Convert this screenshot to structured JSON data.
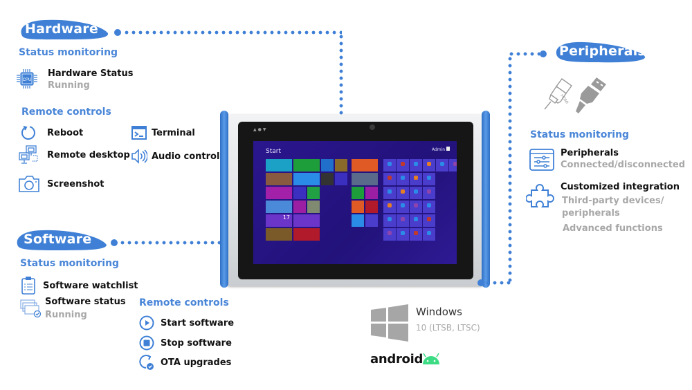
{
  "hardware": {
    "title": "Hardware",
    "status_monitoring": {
      "heading": "Status monitoring",
      "items": [
        {
          "icon": "cpu-icon",
          "label": "Hardware Status",
          "sub": "Running"
        }
      ]
    },
    "remote_controls": {
      "heading": "Remote controls",
      "items": [
        {
          "icon": "reboot-icon",
          "label": "Reboot"
        },
        {
          "icon": "terminal-icon",
          "label": "Terminal"
        },
        {
          "icon": "remote-desktop-icon",
          "label": "Remote desktop"
        },
        {
          "icon": "audio-icon",
          "label": "Audio control"
        },
        {
          "icon": "camera-icon",
          "label": "Screenshot"
        }
      ]
    }
  },
  "software": {
    "title": "Software",
    "status_monitoring": {
      "heading": "Status monitoring",
      "items": [
        {
          "icon": "clipboard-list-icon",
          "label": "Software watchlist"
        },
        {
          "icon": "windows-check-icon",
          "label": "Software status",
          "sub": "Running"
        }
      ]
    },
    "remote_controls": {
      "heading": "Remote controls",
      "items": [
        {
          "icon": "play-icon",
          "label": "Start software"
        },
        {
          "icon": "stop-icon",
          "label": "Stop software"
        },
        {
          "icon": "update-icon",
          "label": "OTA upgrades"
        }
      ]
    }
  },
  "peripherals": {
    "title": "Peripherals",
    "icons": [
      "hdmi-plug-icon",
      "usb-plug-icon"
    ],
    "status_monitoring": {
      "heading": "Status monitoring",
      "items": [
        {
          "icon": "sliders-window-icon",
          "label": "Peripherals",
          "sub": "Connected/disconnected"
        },
        {
          "icon": "puzzle-icon",
          "label": "Customized integration",
          "sub": "Third-party devices/\nperipherals",
          "sub2": "Advanced functions"
        }
      ]
    }
  },
  "os": {
    "windows": {
      "name": "Windows",
      "version": "10 (LTSB, LTSC)"
    },
    "android": {
      "name": "android"
    }
  },
  "tablet_screen": {
    "start_label": "Start",
    "user_label": "Admin",
    "tile_date": "17"
  },
  "colors": {
    "accent": "#3f80d6",
    "heading": "#4a86d8",
    "muted": "#a8a8a8",
    "android_green": "#3ddc84",
    "windows_gray": "#a6a6a6"
  }
}
